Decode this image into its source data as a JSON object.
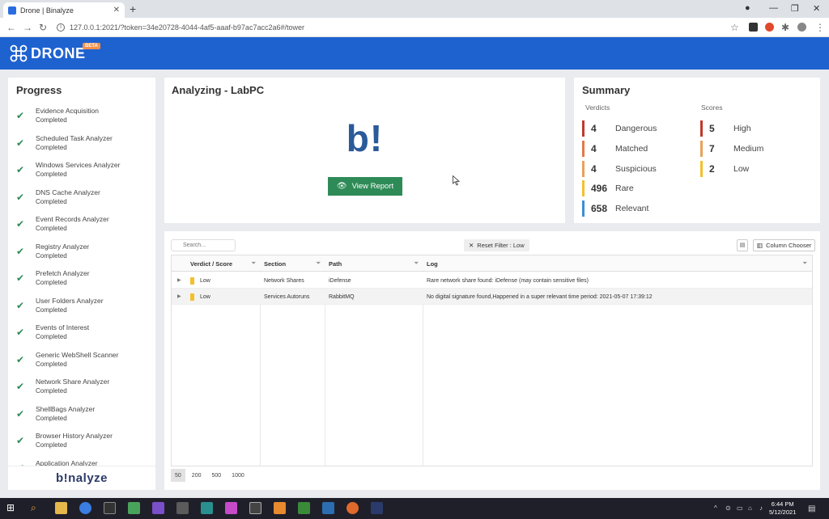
{
  "browser": {
    "tab_title": "Drone | Binalyze",
    "url": "127.0.0.1:2021/?token=34e20728-4044-4af5-aaaf-b97ac7acc2a6#/tower"
  },
  "app": {
    "logo_text": "DRONE",
    "beta_label": "BETA"
  },
  "progress": {
    "title": "Progress",
    "footer_logo": "b!nalyze",
    "items": [
      {
        "name": "Evidence Acquisition",
        "status": "Completed"
      },
      {
        "name": "Scheduled Task Analyzer",
        "status": "Completed"
      },
      {
        "name": "Windows Services Analyzer",
        "status": "Completed"
      },
      {
        "name": "DNS Cache Analyzer",
        "status": "Completed"
      },
      {
        "name": "Event Records Analyzer",
        "status": "Completed"
      },
      {
        "name": "Registry Analyzer",
        "status": "Completed"
      },
      {
        "name": "Prefetch Analyzer",
        "status": "Completed"
      },
      {
        "name": "User Folders Analyzer",
        "status": "Completed"
      },
      {
        "name": "Events of Interest",
        "status": "Completed"
      },
      {
        "name": "Generic WebShell Scanner",
        "status": "Completed"
      },
      {
        "name": "Network Share Analyzer",
        "status": "Completed"
      },
      {
        "name": "ShellBags Analyzer",
        "status": "Completed"
      },
      {
        "name": "Browser History Analyzer",
        "status": "Completed"
      },
      {
        "name": "Application Analyzer",
        "status": ""
      }
    ]
  },
  "analyzing": {
    "title": "Analyzing - LabPC",
    "big_logo": "b!",
    "view_report_label": "View Report"
  },
  "summary": {
    "title": "Summary",
    "verdicts_label": "Verdicts",
    "scores_label": "Scores",
    "verdicts": [
      {
        "count": "4",
        "label": "Dangerous",
        "color": "#c0392b"
      },
      {
        "count": "4",
        "label": "Matched",
        "color": "#e07b4a"
      },
      {
        "count": "4",
        "label": "Suspicious",
        "color": "#e8a25a"
      },
      {
        "count": "496",
        "label": "Rare",
        "color": "#f3c02c"
      },
      {
        "count": "658",
        "label": "Relevant",
        "color": "#3a8fd6"
      }
    ],
    "scores": [
      {
        "count": "5",
        "label": "High",
        "color": "#c0392b"
      },
      {
        "count": "7",
        "label": "Medium",
        "color": "#e8a25a"
      },
      {
        "count": "2",
        "label": "Low",
        "color": "#f3c02c"
      }
    ]
  },
  "table": {
    "search_placeholder": "Search...",
    "reset_filter_label": "Reset Filter : Low",
    "column_chooser_label": "Column Chooser",
    "columns": [
      "Verdict / Score",
      "Section",
      "Path",
      "Log"
    ],
    "rows": [
      {
        "verdict": "Low",
        "section": "Network Shares",
        "path": "iDefense",
        "log": "Rare network share found: iDefense (may contain sensitive files)"
      },
      {
        "verdict": "Low",
        "section": "Services Autoruns",
        "path": "RabbitMQ",
        "log": "No digital signature found,Happened in a super relevant time period: 2021-05-07 17:39:12"
      }
    ],
    "page_sizes": [
      "50",
      "200",
      "500",
      "1000"
    ],
    "active_page_size": "50"
  },
  "taskbar": {
    "time": "6:44 PM",
    "date": "5/12/2021"
  }
}
